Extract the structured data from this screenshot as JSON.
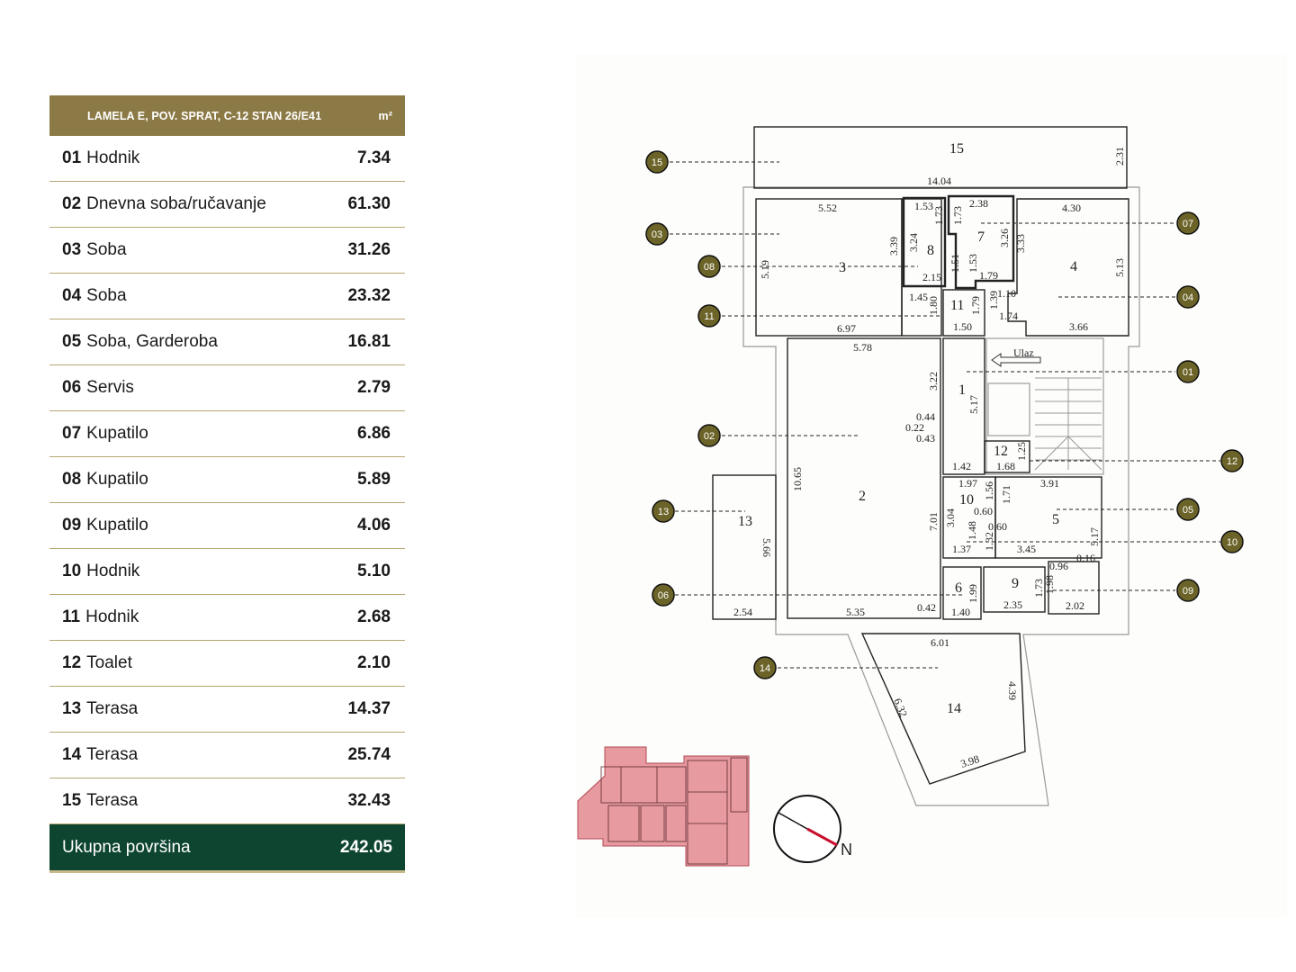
{
  "table": {
    "header_title": "LAMELA E, POV. SPRAT, C-12 STAN 26/E41",
    "header_unit": "m²",
    "rows": [
      {
        "num": "01",
        "name": "Hodnik",
        "area": "7.34"
      },
      {
        "num": "02",
        "name": "Dnevna soba/ručavanje",
        "area": "61.30"
      },
      {
        "num": "03",
        "name": "Soba",
        "area": "31.26"
      },
      {
        "num": "04",
        "name": "Soba",
        "area": "23.32"
      },
      {
        "num": "05",
        "name": "Soba, Garderoba",
        "area": "16.81"
      },
      {
        "num": "06",
        "name": "Servis",
        "area": "2.79"
      },
      {
        "num": "07",
        "name": "Kupatilo",
        "area": "6.86"
      },
      {
        "num": "08",
        "name": "Kupatilo",
        "area": "5.89"
      },
      {
        "num": "09",
        "name": "Kupatilo",
        "area": "4.06"
      },
      {
        "num": "10",
        "name": "Hodnik",
        "area": "5.10"
      },
      {
        "num": "11",
        "name": "Hodnik",
        "area": "2.68"
      },
      {
        "num": "12",
        "name": "Toalet",
        "area": "2.10"
      },
      {
        "num": "13",
        "name": "Terasa",
        "area": "14.37"
      },
      {
        "num": "14",
        "name": "Terasa",
        "area": "25.74"
      },
      {
        "num": "15",
        "name": "Terasa",
        "area": "32.43"
      }
    ],
    "total_label": "Ukupna površina",
    "total_value": "242.05"
  },
  "plan": {
    "entrance_label": "Ulaz",
    "room_numbers": [
      "15",
      "3",
      "8",
      "7",
      "4",
      "11",
      "1",
      "2",
      "12",
      "10",
      "5",
      "13",
      "6",
      "9",
      "14"
    ],
    "dimensions": [
      "14.04",
      "2.31",
      "5.52",
      "3.39",
      "1.53",
      "1.73",
      "3.24",
      "1.51",
      "2.15",
      "2.38",
      "1.73",
      "3.26",
      "1.53",
      "1.79",
      "3.33",
      "4.30",
      "5.13",
      "1.10",
      "1.74",
      "3.66",
      "5.19",
      "1.45",
      "1.80",
      "1.79",
      "1.50",
      "1.39",
      "6.97",
      "5.78",
      "3.22",
      "5.17",
      "0.44",
      "0.22",
      "0.43",
      "1.42",
      "1.25",
      "1.68",
      "10.65",
      "1.97",
      "1.56",
      "1.71",
      "3.91",
      "0.60",
      "0.60",
      "3.04",
      "1.48",
      "1.32",
      "1.37",
      "3.45",
      "7.01",
      "5.17",
      "0.16",
      "0.96",
      "1.99",
      "1.40",
      "1.73",
      "2.35",
      "1.98",
      "2.02",
      "5.66",
      "2.54",
      "5.35",
      "0.42",
      "6.01",
      "6.32",
      "4.39",
      "3.98"
    ],
    "markers": [
      "15",
      "03",
      "08",
      "11",
      "02",
      "13",
      "06",
      "14",
      "07",
      "04",
      "01",
      "12",
      "05",
      "10",
      "09"
    ],
    "compass_label": "N",
    "marker_color": "#6b6327",
    "key_plan_color": "#e79a9f",
    "compass_needle_color": "#c8102e"
  }
}
